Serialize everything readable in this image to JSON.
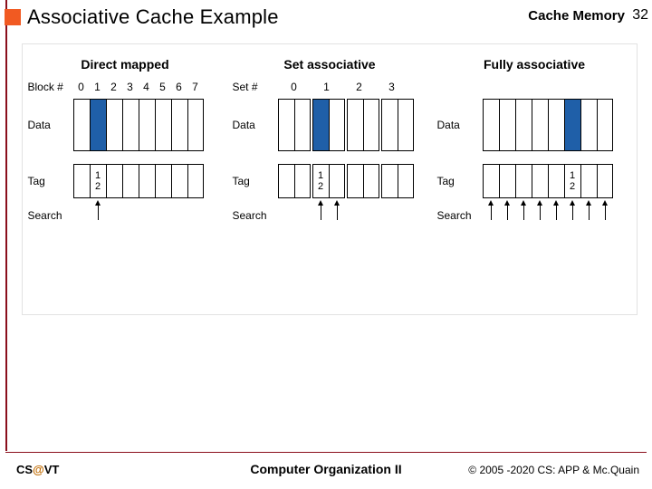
{
  "header": {
    "title": "Associative Cache Example",
    "topic": "Cache Memory",
    "page": "32"
  },
  "footer": {
    "left_pre": "CS",
    "left_at": "@",
    "left_post": "VT",
    "center": "Computer Organization II",
    "right": "© 2005 -2020 CS: APP & Mc.Quain"
  },
  "labels": {
    "data": "Data",
    "tag": "Tag",
    "search": "Search"
  },
  "panels": {
    "direct": {
      "title": "Direct mapped",
      "index_label": "Block #",
      "indices": [
        "0",
        "1",
        "2",
        "3",
        "4",
        "5",
        "6",
        "7"
      ],
      "highlight": [
        1
      ],
      "tag_vals": [
        "1",
        "2"
      ],
      "search_arrows": [
        1
      ]
    },
    "set": {
      "title": "Set associative",
      "index_label": "Set #",
      "indices": [
        "0",
        "1",
        "2",
        "3"
      ],
      "highlight": [
        2,
        3
      ],
      "tag_vals": [
        "1",
        "2"
      ],
      "search_arrows": [
        2,
        3
      ]
    },
    "full": {
      "title": "Fully associative",
      "index_label": "",
      "highlight": [
        5
      ],
      "tag_vals": [
        "1",
        "2"
      ],
      "search_arrows": [
        0,
        1,
        2,
        3,
        4,
        5,
        6,
        7
      ]
    }
  }
}
